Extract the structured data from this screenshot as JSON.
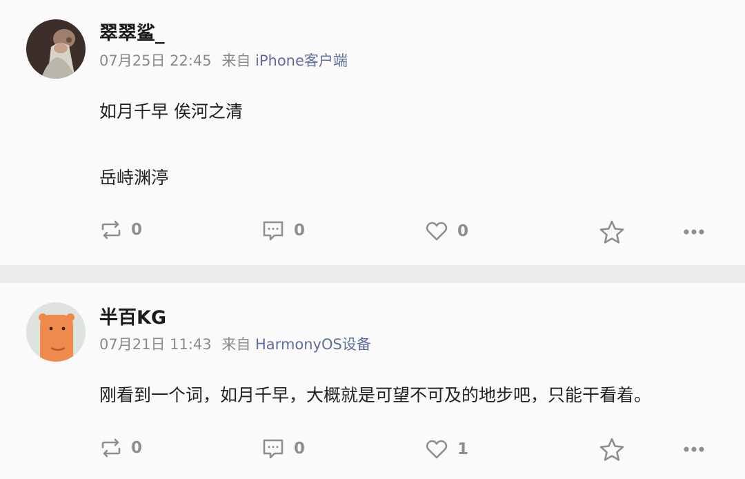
{
  "posts": [
    {
      "author": "翠翠鲨_",
      "date": "07月25日 22:45",
      "via": "来自",
      "source": "iPhone客户端",
      "lines": [
        "如月千早 俟河之清",
        "岳峙渊渟"
      ],
      "actions": {
        "repost": "0",
        "comment": "0",
        "like": "0"
      }
    },
    {
      "author": "半百KG",
      "date": "07月21日 11:43",
      "via": "来自",
      "source": "HarmonyOS设备",
      "lines": [
        "刚看到一个词，如月千早，大概就是可望不可及的地步吧，只能干看着。"
      ],
      "actions": {
        "repost": "0",
        "comment": "0",
        "like": "1"
      }
    }
  ],
  "icons": {
    "repost": "repost-icon",
    "comment": "comment-icon",
    "like": "heart-icon",
    "favorite": "star-icon",
    "more": "more-icon"
  },
  "colors": {
    "source_link": "#5d6c9d",
    "icon": "#8e8e8e",
    "divider": "#ebebeb"
  }
}
